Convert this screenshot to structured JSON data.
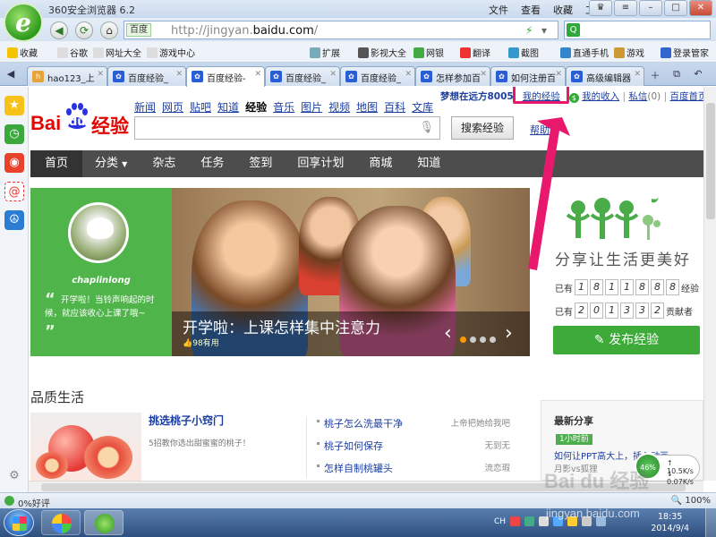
{
  "browser": {
    "title": "360安全浏览器 6.2",
    "menu": [
      "文件",
      "查看",
      "收藏",
      "工具",
      "帮助"
    ],
    "url_site_label": "百度",
    "url_prefix": "http://jingyan.",
    "url_domain": "baidu.com",
    "url_suffix": "/",
    "search_placeholder": ""
  },
  "favorites": [
    "收藏",
    "谷歌",
    "网址大全",
    "游戏中心",
    "扩展",
    "影视大全",
    "网银",
    "翻译",
    "截图",
    "直通手机",
    "游戏",
    "登录管家"
  ],
  "tabs": [
    {
      "label": "hao123_上",
      "active": false
    },
    {
      "label": "百度经验_",
      "active": false
    },
    {
      "label": "百度经验-",
      "active": true
    },
    {
      "label": "百度经验_",
      "active": false
    },
    {
      "label": "百度经验_",
      "active": false
    },
    {
      "label": "怎样参加百",
      "active": false
    },
    {
      "label": "如何注册百",
      "active": false
    },
    {
      "label": "高级编辑器",
      "active": false
    }
  ],
  "page": {
    "logo_bai": "Bai",
    "logo_du": "du",
    "logo_jingyan": "经验",
    "topnav": [
      "新闻",
      "网页",
      "贴吧",
      "知道",
      "经验",
      "音乐",
      "图片",
      "视频",
      "地图",
      "百科",
      "文库"
    ],
    "current_nav": "经验",
    "user_name": "梦想在远方8005",
    "my_experience": "我的经验",
    "my_income": "我的收入",
    "messages": "私信",
    "message_count": "(0)",
    "baidu_home": "百度首页",
    "search_button": "搜索经验",
    "help": "帮助",
    "catnav": [
      "首页",
      "分类",
      "杂志",
      "任务",
      "签到",
      "回享计划",
      "商城",
      "知道"
    ],
    "banner": {
      "author": "chaplinlong",
      "quote": "开学啦！当铃声响起的时候，就应该收心上课了哦~",
      "title": "开学啦：上课怎样集中注意力",
      "likes": "98有用"
    },
    "slogan": "分享让生活更美好",
    "counters": {
      "existing_label_pre": "已有",
      "experience_digits": [
        "1",
        "8",
        "1",
        "1",
        "8",
        "8",
        "8"
      ],
      "experience_label": "经验",
      "contributor_digits": [
        "2",
        "0",
        "1",
        "3",
        "3",
        "2"
      ],
      "contributor_label": "贡献者"
    },
    "publish_button": "发布经验",
    "section_title": "品质生活",
    "feature": {
      "title": "挑选桃子小窍门",
      "desc": "5招教你选出甜蜜蜜的桃子！"
    },
    "list": [
      {
        "title": "桃子怎么洗最干净",
        "author": "上帝把她给我吧"
      },
      {
        "title": "桃子如何保存",
        "author": "无到无"
      },
      {
        "title": "怎样自制桃罐头",
        "author": "流恋瑕"
      }
    ],
    "latest": {
      "title": "最新分享",
      "time": "1小时前",
      "item": "如何让PPT高大上，插入动画",
      "sub": "月影vs狐狸"
    }
  },
  "widgets": {
    "speed_percent": "46%",
    "upload": "10.5K/s",
    "download": "0.07K/s"
  },
  "status": {
    "left": "0%好评",
    "zoom": "100%"
  },
  "taskbar": {
    "lang": "CH",
    "time": "18:35",
    "date": "2014/9/4"
  },
  "watermark": {
    "main": "Bai du 经验",
    "sub": "jingyan.baidu.com"
  },
  "colors": {
    "accent_red": "#e10601",
    "link_blue": "#1b3ea0",
    "green": "#3daa3a",
    "highlight_pink": "#e8196d"
  }
}
